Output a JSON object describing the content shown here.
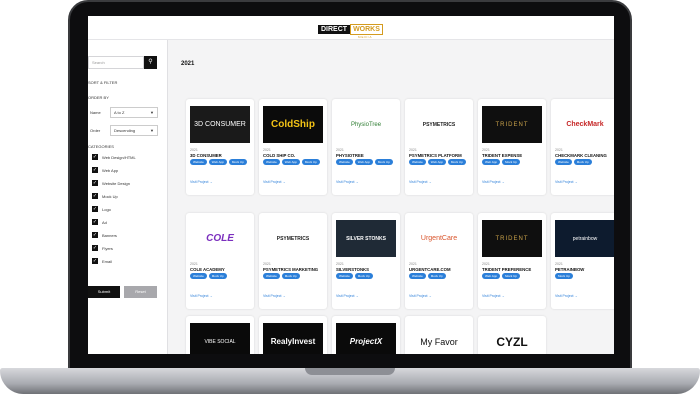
{
  "brand": {
    "part1": "DIRECT",
    "part2": "WORKS",
    "sub": "MEDIA"
  },
  "sidebar": {
    "search_placeholder": "Search",
    "search_icon": "search-icon",
    "heading": "Sort & Filter",
    "order_heading": "Order By",
    "name_label": "Name",
    "name_value": "A to Z",
    "order_label": "Order",
    "order_value": "Descending",
    "categories_heading": "Categories",
    "categories": [
      "Web Design/HTML",
      "Web App",
      "Website Design",
      "Mock Up",
      "Logo",
      "Ad",
      "Banners",
      "Flyers",
      "Email"
    ],
    "submit_label": "Submit",
    "reset_label": "Reset"
  },
  "main": {
    "year_heading": "2021",
    "visit_label": "Visit Project →",
    "cards": [
      {
        "year": "2021",
        "title": "3D CONSUMER",
        "logo": "3D CONSUMER",
        "tags": [
          "Website",
          "Web App",
          "Mock Up"
        ]
      },
      {
        "year": "2021",
        "title": "COLD SHIP CO.",
        "logo": "ColdShip",
        "tags": [
          "Website",
          "Web App",
          "Mock Up"
        ]
      },
      {
        "year": "2021",
        "title": "PHYSIOTREE",
        "logo": "PhysioTree",
        "tags": [
          "Website",
          "Web App",
          "Mock Up"
        ]
      },
      {
        "year": "2021",
        "title": "PSYMETRICS PLATFORM",
        "logo": "PSYMETRICS",
        "tags": [
          "Website",
          "Web App",
          "Mock Up"
        ]
      },
      {
        "year": "2021",
        "title": "TRIDENT EXPENSE",
        "logo": "TRIDENT",
        "tags": [
          "Web App",
          "Mock Up"
        ]
      },
      {
        "year": "2021",
        "title": "CHECKMARK CLEANING",
        "logo": "CheckMark",
        "tags": [
          "Website",
          "Mock Up"
        ]
      },
      {
        "year": "2021",
        "title": "COLE ACADEMY",
        "logo": "COLE",
        "tags": [
          "Website",
          "Mock Up"
        ]
      },
      {
        "year": "2021",
        "title": "PSYMETRICS MARKETING",
        "logo": "PSYMETRICS",
        "tags": [
          "Website",
          "Mock Up"
        ]
      },
      {
        "year": "2021",
        "title": "SILVERSTONKS",
        "logo": "SILVER STONKS",
        "tags": [
          "Website",
          "Mock Up"
        ]
      },
      {
        "year": "2021",
        "title": "URGENTCARE.COM",
        "logo": "UrgentCare",
        "tags": [
          "Website",
          "Mock Up"
        ]
      },
      {
        "year": "2021",
        "title": "TRIDENT PREFERENCE",
        "logo": "TRIDENT",
        "tags": [
          "Web App",
          "Mock Up"
        ]
      },
      {
        "year": "2021",
        "title": "PETRAINBOW",
        "logo": "petrainbow",
        "tags": [
          "Mock Up"
        ]
      },
      {
        "year": "2021",
        "title": "",
        "logo": "VIBE SOCIAL",
        "tags": []
      },
      {
        "year": "2021",
        "title": "",
        "logo": "RealyInvest",
        "tags": []
      },
      {
        "year": "2021",
        "title": "",
        "logo": "ProjectX",
        "tags": []
      },
      {
        "year": "2021",
        "title": "",
        "logo": "My Favor",
        "tags": []
      },
      {
        "year": "2021",
        "title": "",
        "logo": "CYZL",
        "tags": []
      }
    ]
  },
  "colors": {
    "accent": "#2b7fd9",
    "dark": "#111111",
    "gold": "#d49b1f"
  }
}
